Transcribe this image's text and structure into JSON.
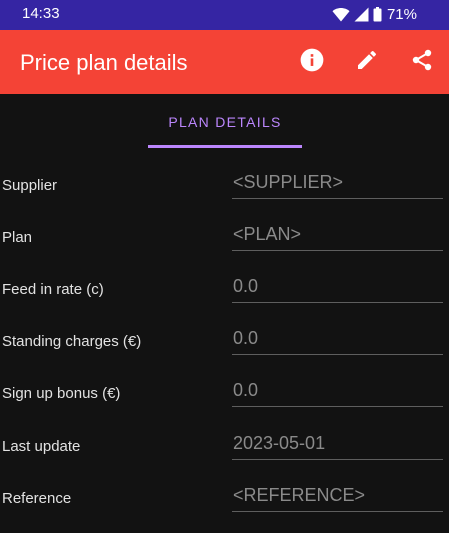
{
  "status_bar": {
    "time": "14:33",
    "battery_percent": "71%",
    "icons": [
      "wifi-icon",
      "cellular-signal-icon",
      "battery-icon"
    ]
  },
  "app_bar": {
    "title": "Price plan details",
    "background_color": "#f44336",
    "actions": [
      "info-icon",
      "edit-icon",
      "share-icon"
    ]
  },
  "tabs": [
    {
      "label": "PLAN DETAILS",
      "selected": true,
      "accent_color": "#bb86fc"
    }
  ],
  "fields": [
    {
      "label": "Supplier",
      "value": "<SUPPLIER>"
    },
    {
      "label": "Plan",
      "value": "<PLAN>"
    },
    {
      "label": "Feed in rate (c)",
      "value": "0.0"
    },
    {
      "label": "Standing charges (€)",
      "value": "0.0"
    },
    {
      "label": "Sign up bonus (€)",
      "value": "0.0"
    },
    {
      "label": "Last update",
      "value": "2023-05-01"
    },
    {
      "label": "Reference",
      "value": "<REFERENCE>"
    }
  ]
}
